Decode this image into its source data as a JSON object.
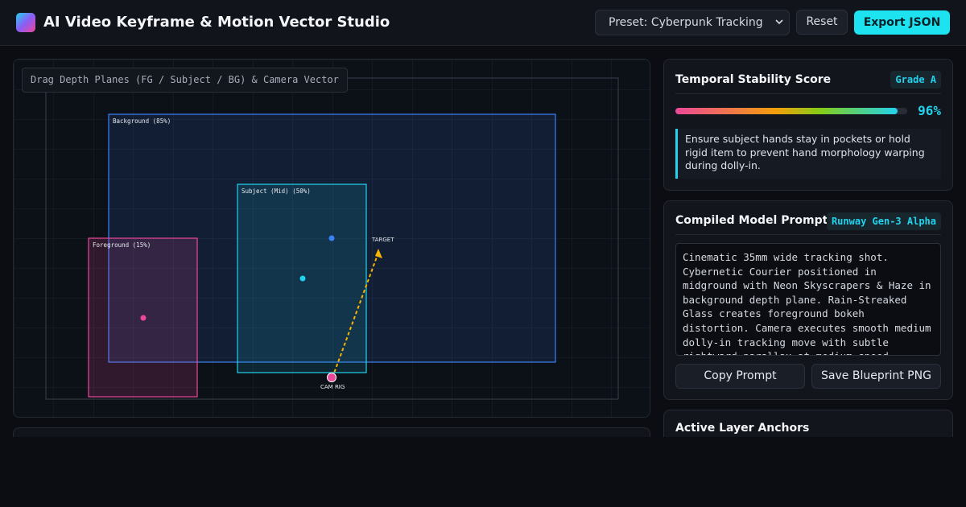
{
  "header": {
    "title": "AI Video Keyframe & Motion Vector Studio",
    "preset_label": "Preset: Cyberpunk Tracking",
    "reset_label": "Reset",
    "export_label": "Export JSON"
  },
  "canvas": {
    "hint": "Drag Depth Planes (FG / Subject / BG) & Camera Vector",
    "planes": {
      "background": "Background (85%)",
      "subject": "Subject (Mid) (50%)",
      "foreground": "Foreground (15%)"
    },
    "target_label": "TARGET",
    "cam_label": "CAM RIG"
  },
  "stability": {
    "title": "Temporal Stability Score",
    "grade": "Grade A",
    "score_text": "96%",
    "score": 0.96,
    "note": "Ensure subject hands stay in pockets or hold rigid item to prevent hand morphology warping during dolly-in."
  },
  "prompt": {
    "title": "Compiled Model Prompt",
    "model": "Runway Gen-3 Alpha",
    "text": "Cinematic 35mm wide tracking shot. Cybernetic Courier positioned in midground with Neon Skyscrapers & Haze in background depth plane. Rain-Streaked Glass creates foreground bokeh distortion. Camera executes smooth medium dolly-in tracking move with subtle rightward parallax at medium speed.",
    "copy_label": "Copy Prompt",
    "save_label": "Save Blueprint PNG"
  },
  "anchors": {
    "title": "Active Layer Anchors"
  },
  "colors": {
    "accent": "#22d3ee",
    "background_plane": "#3b82f6",
    "subject_plane": "#22d3ee",
    "foreground_plane": "#ec4899",
    "vector": "#f5b400"
  }
}
